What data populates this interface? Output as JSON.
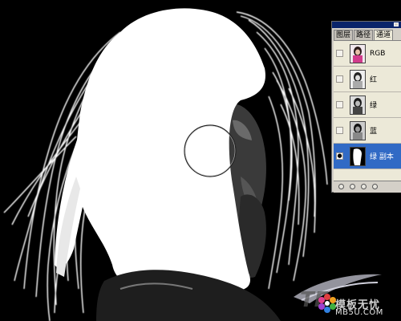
{
  "panel": {
    "tabs": [
      {
        "label": "图层",
        "active": false
      },
      {
        "label": "路径",
        "active": false
      },
      {
        "label": "通道",
        "active": true
      }
    ],
    "channels": [
      {
        "name": "RGB",
        "visible": false,
        "selected": false,
        "thumb": "color"
      },
      {
        "name": "红",
        "visible": false,
        "selected": false,
        "thumb": "gray-light"
      },
      {
        "name": "绿",
        "visible": false,
        "selected": false,
        "thumb": "gray-mid"
      },
      {
        "name": "蓝",
        "visible": false,
        "selected": false,
        "thumb": "gray-dark"
      },
      {
        "name": "绿 副本",
        "visible": true,
        "selected": true,
        "thumb": "mask"
      }
    ],
    "selected_color": "#316ac5"
  },
  "canvas": {
    "brush_cursor": "circle-brush-cursor"
  },
  "watermark": {
    "text": "模板无忧",
    "url": "MB5U.COM"
  }
}
